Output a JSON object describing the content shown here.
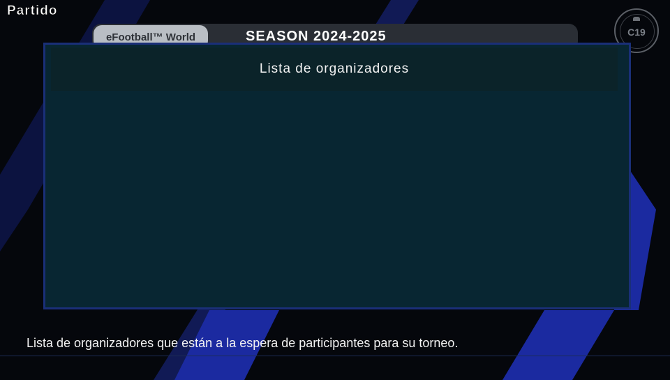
{
  "header": {
    "title": "Partido"
  },
  "season": {
    "tag": "eFootball™ World",
    "label": "SEASON  2024-2025"
  },
  "emblem": {
    "text": "C19",
    "icon": "league-emblem-icon"
  },
  "panel": {
    "title": "Lista de organizadores"
  },
  "footer": {
    "description": "Lista de organizadores que están a la espera de participantes para su torneo."
  },
  "colors": {
    "background": "#05070c",
    "panel": "#082632",
    "panel_border": "#1a2f78",
    "stripe": "#1a2a9a"
  }
}
